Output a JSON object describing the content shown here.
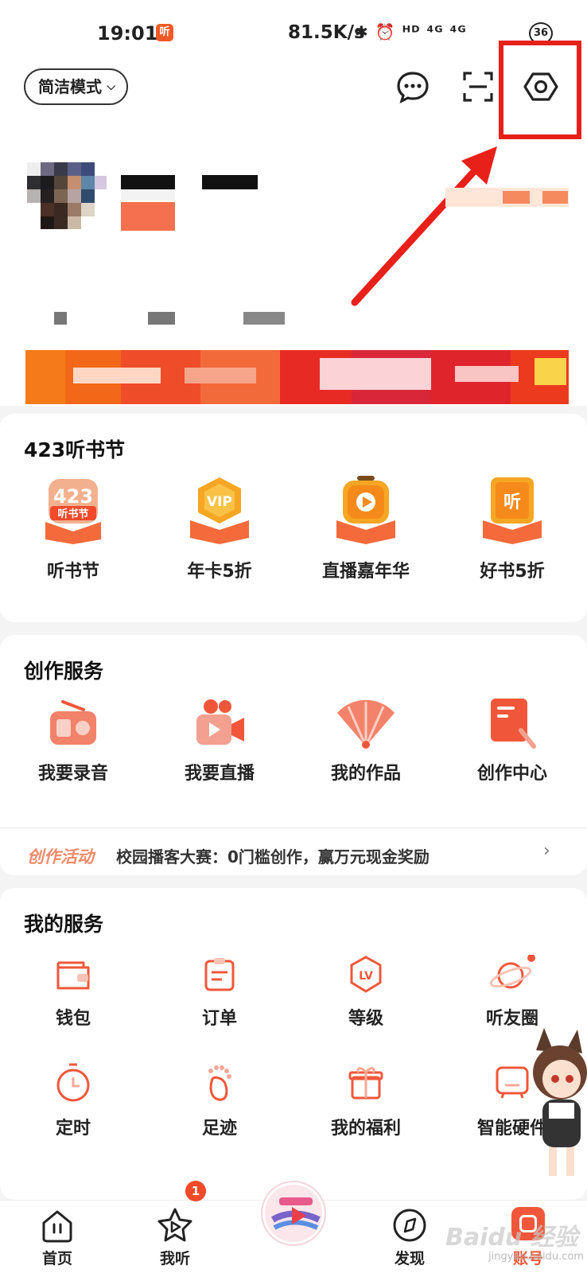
{
  "status_bar": {
    "time": "19:01",
    "app_badge": "听",
    "net_speed": "81.5K/s",
    "icons_text": "✱ ⏰ ᴴᴰ ⁴ᴳ ⁴ᴳ",
    "battery": "36"
  },
  "header": {
    "mode_label": "简洁模式",
    "icons": [
      "message-icon",
      "scan-icon",
      "settings-icon"
    ]
  },
  "festival": {
    "title": "423听书节",
    "items": [
      {
        "label": "听书节",
        "icon": "festival-423-icon",
        "icon_text": "423"
      },
      {
        "label": "年卡5折",
        "icon": "vip-icon",
        "icon_text": "VIP"
      },
      {
        "label": "直播嘉年华",
        "icon": "live-play-icon",
        "icon_text": ""
      },
      {
        "label": "好书5折",
        "icon": "book-listen-icon",
        "icon_text": "听"
      }
    ]
  },
  "creation": {
    "title": "创作服务",
    "items": [
      {
        "label": "我要录音",
        "icon": "radio-icon"
      },
      {
        "label": "我要直播",
        "icon": "camera-icon"
      },
      {
        "label": "我的作品",
        "icon": "fan-icon"
      },
      {
        "label": "创作中心",
        "icon": "edit-center-icon"
      }
    ],
    "activity_tag": "创作活动",
    "activity_text": "校园播客大赛：0门槛创作，赢万元现金奖励"
  },
  "services": {
    "title": "我的服务",
    "row1": [
      {
        "label": "钱包",
        "icon": "wallet-icon"
      },
      {
        "label": "订单",
        "icon": "order-icon"
      },
      {
        "label": "等级",
        "icon": "level-icon",
        "icon_text": "LV"
      },
      {
        "label": "听友圈",
        "icon": "planet-icon"
      }
    ],
    "row2": [
      {
        "label": "定时",
        "icon": "timer-icon"
      },
      {
        "label": "足迹",
        "icon": "footprint-icon"
      },
      {
        "label": "我的福利",
        "icon": "gift-icon"
      },
      {
        "label": "智能硬件",
        "icon": "device-icon"
      }
    ]
  },
  "tabbar": {
    "tabs": [
      {
        "label": "首页",
        "icon": "home-icon"
      },
      {
        "label": "我听",
        "icon": "star-play-icon"
      },
      {
        "label": "发现",
        "icon": "compass-icon"
      },
      {
        "label": "账号",
        "icon": "account-icon"
      }
    ],
    "badge": "1"
  },
  "watermark": {
    "text": "Baidu 经验",
    "sub": "jingyan.baidu.com"
  },
  "colors": {
    "accent": "#f0573a",
    "highlight": "#e8201a",
    "card": "#ffffff",
    "background": "#f4f4f4"
  }
}
